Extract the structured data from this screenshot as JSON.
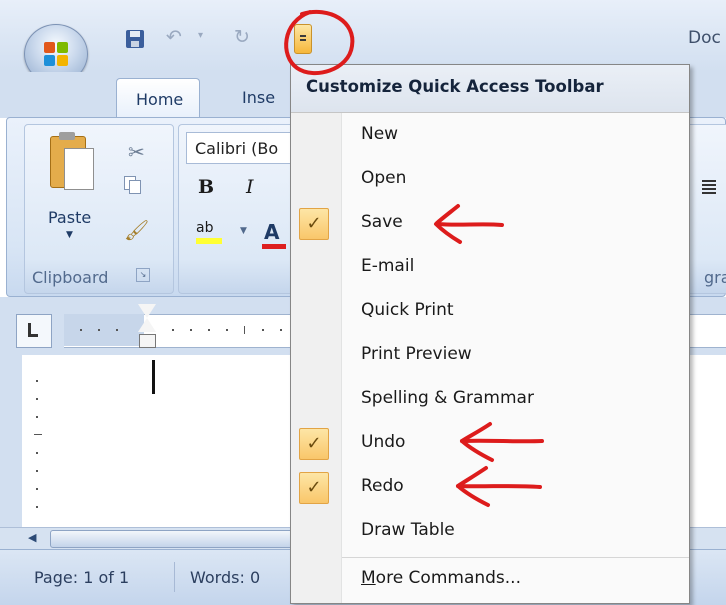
{
  "window": {
    "doc_title": "Doc"
  },
  "ribbon": {
    "tabs": {
      "home": "Home",
      "insert": "Inse"
    },
    "clipboard": {
      "paste_label": "Paste",
      "group_label": "Clipboard"
    },
    "font": {
      "name": "Calibri (Bo",
      "bold": "B",
      "italic": "I",
      "highlight_text": "ab",
      "font_color_text": "A"
    },
    "paragraph": {
      "group_label_partial": "gra"
    }
  },
  "qat_menu": {
    "title": "Customize Quick Access Toolbar",
    "items": [
      {
        "label": "New",
        "checked": false
      },
      {
        "label": "Open",
        "checked": false
      },
      {
        "label": "Save",
        "checked": true
      },
      {
        "label": "E-mail",
        "checked": false
      },
      {
        "label": "Quick Print",
        "checked": false
      },
      {
        "label": "Print Preview",
        "checked": false
      },
      {
        "label": "Spelling & Grammar",
        "checked": false
      },
      {
        "label": "Undo",
        "checked": true
      },
      {
        "label": "Redo",
        "checked": true
      },
      {
        "label": "Draw Table",
        "checked": false
      },
      {
        "label": "More Commands...",
        "checked": false
      }
    ],
    "check_glyph": "✓"
  },
  "status_bar": {
    "page": "Page: 1 of 1",
    "words": "Words: 0"
  },
  "icons": {
    "office_button": "office-logo-icon",
    "save": "save-icon",
    "undo": "undo-icon",
    "redo": "redo-icon",
    "customize": "dropdown-icon"
  },
  "colors": {
    "annotation_red": "#dd1c1c",
    "check_highlight": "#f9c66a",
    "ribbon_blue": "#d2dff0"
  }
}
